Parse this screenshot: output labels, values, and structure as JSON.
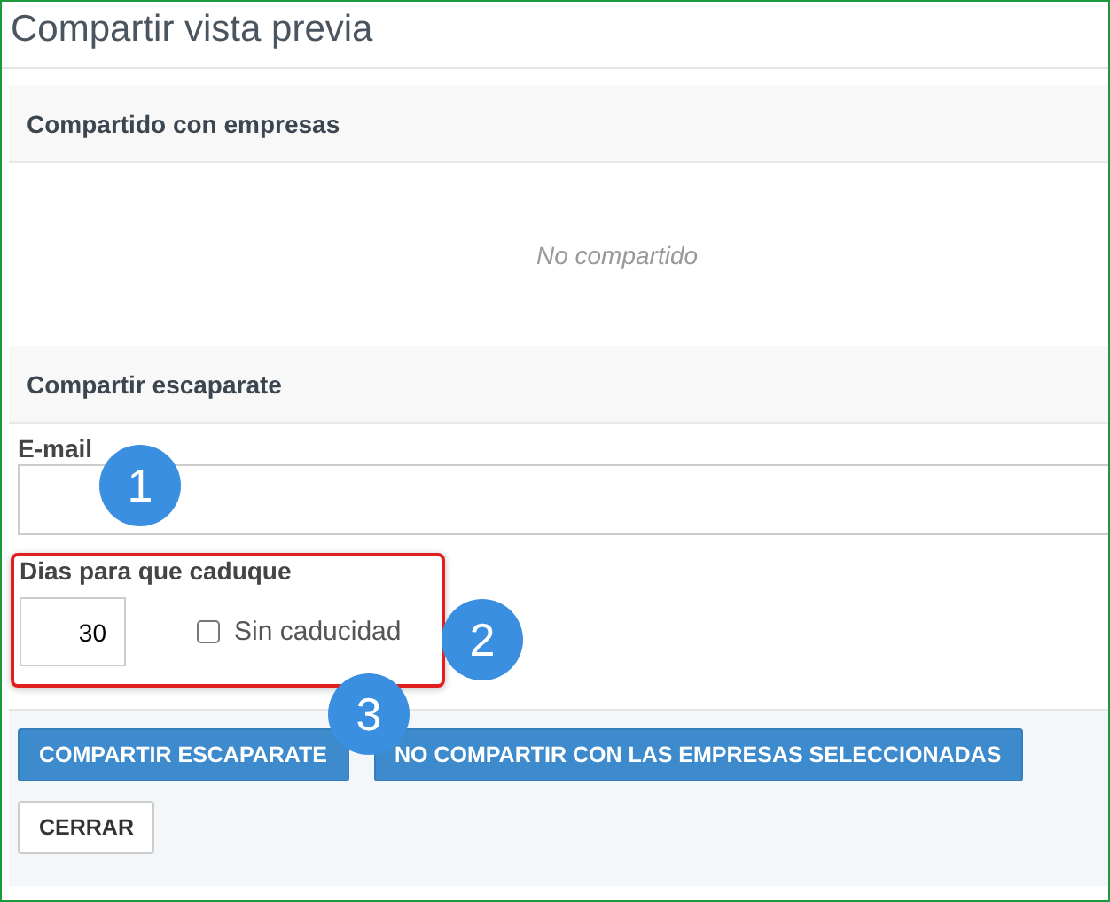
{
  "title": "Compartir vista previa",
  "shared_section": {
    "heading": "Compartido con empresas",
    "empty_text": "No compartido"
  },
  "share_section": {
    "heading": "Compartir escaparate",
    "email": {
      "label": "E-mail"
    },
    "days": {
      "label": "Dias para que caduque",
      "value": "30"
    },
    "no_expiry": {
      "label": "Sin caducidad",
      "checked": false
    }
  },
  "buttons": [
    {
      "label": "COMPARTIR ESCAPARATE",
      "kind": "primary"
    },
    {
      "label": "NO COMPARTIR CON LAS EMPRESAS SELECCIONADAS",
      "kind": "primary"
    },
    {
      "label": "CERRAR",
      "kind": "default"
    }
  ],
  "callouts": [
    "1",
    "2",
    "3"
  ]
}
